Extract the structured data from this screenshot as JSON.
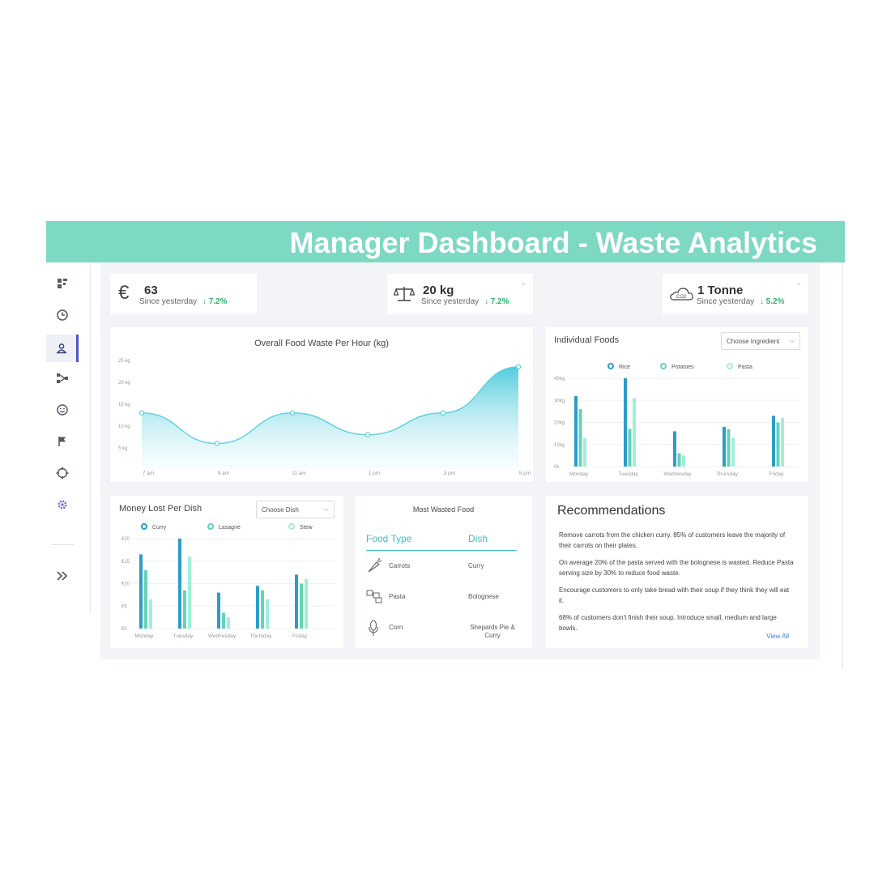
{
  "banner": {
    "title": "Manager Dashboard - Waste Analytics"
  },
  "sidebar": {
    "items": [
      {
        "icon": "dashboard-icon",
        "active": false
      },
      {
        "icon": "clock-icon",
        "active": false
      },
      {
        "icon": "user-icon",
        "active": true
      },
      {
        "icon": "flow-icon",
        "active": false
      },
      {
        "icon": "smiley-icon",
        "active": false
      },
      {
        "icon": "flag-icon",
        "active": false
      },
      {
        "icon": "target-icon",
        "active": false
      },
      {
        "icon": "settings-icon",
        "active": false
      }
    ],
    "expand_icon": "double-chevron-right-icon"
  },
  "stats": [
    {
      "icon": "euro-icon",
      "value": "63",
      "label": "Since yesterday",
      "change": "7.2%",
      "direction": "down"
    },
    {
      "icon": "scale-icon",
      "value": "20 kg",
      "label": "Since yesterday",
      "change": "7.2%",
      "direction": "down"
    },
    {
      "icon": "co2-cloud-icon",
      "icon_text": "CO2",
      "value": "1 Tonne",
      "label": "Since yesterday",
      "change": "5.2%",
      "direction": "down"
    }
  ],
  "colors": {
    "accent": "#7dd8c4",
    "series_dark": "#2e9cc8",
    "series_mid": "#66d1b8",
    "series_light": "#9ff0d6",
    "positive": "#2fb36f",
    "link": "#3d7fd6"
  },
  "chart_data": [
    {
      "type": "area",
      "title": "Overall Food Waste Per Hour (kg)",
      "x": [
        "7 am",
        "9 am",
        "11 am",
        "1 pm",
        "3 pm",
        "5 pm"
      ],
      "values": [
        13,
        6,
        13,
        8,
        13,
        23.5
      ],
      "y_ticks": [
        "25 kg",
        "20 kg",
        "15 kg",
        "10 kg",
        "5 kg"
      ],
      "y_tick_values": [
        25,
        20,
        15,
        10,
        5
      ],
      "ylim": [
        0,
        27
      ],
      "grid": false
    },
    {
      "type": "bar",
      "title": "Individual Foods",
      "dropdown": "Choose Ingredient",
      "categories": [
        "Monday",
        "Tuesday",
        "Wednesday",
        "Thursday",
        "Friday"
      ],
      "series": [
        {
          "name": "Rice",
          "values": [
            32,
            40,
            16,
            18,
            23
          ]
        },
        {
          "name": "Potatoes",
          "values": [
            26,
            17,
            6,
            17,
            20
          ]
        },
        {
          "name": "Pasta",
          "values": [
            13,
            31,
            5,
            13,
            22
          ]
        }
      ],
      "y_ticks": [
        "40kg",
        "30kg",
        "20kg",
        "10kg",
        "0k"
      ],
      "y_tick_values": [
        40,
        30,
        20,
        10,
        0
      ],
      "ylim": [
        0,
        40
      ],
      "grid": true,
      "legend": "top"
    },
    {
      "type": "bar",
      "title": "Money Lost Per Dish",
      "dropdown": "Choose Dish",
      "categories": [
        "Monday",
        "Tuesday",
        "Wednesday",
        "Thursday",
        "Friday"
      ],
      "series": [
        {
          "name": "Curry",
          "values": [
            16.5,
            20,
            8,
            9.5,
            12
          ]
        },
        {
          "name": "Lasagne",
          "values": [
            13,
            8.5,
            3.5,
            8.5,
            10
          ]
        },
        {
          "name": "Stew",
          "values": [
            6.5,
            16,
            2.5,
            6.5,
            11
          ]
        }
      ],
      "y_ticks": [
        "€20",
        "€15",
        "€10",
        "€5",
        "€0"
      ],
      "y_tick_values": [
        20,
        15,
        10,
        5,
        0
      ],
      "ylim": [
        0,
        20
      ],
      "grid": true,
      "legend": "top"
    }
  ],
  "most_wasted": {
    "title": "Most Wasted Food",
    "col_food": "Food Type",
    "col_dish": "Dish",
    "rows": [
      {
        "icon": "carrot-icon",
        "food": "Carrots",
        "dish": "Curry"
      },
      {
        "icon": "pasta-icon",
        "food": "Pasta",
        "dish": "Bolognese"
      },
      {
        "icon": "corn-icon",
        "food": "Corn",
        "dish": "Shepards Pie & Curry"
      }
    ]
  },
  "recommendations": {
    "title": "Recommendations",
    "items": [
      "Remove carrots from the chicken curry. 85% of customers leave the majority of their carrots on their plates.",
      "On average 20% of the pasta served with the bolognese is wasted. Reduce Pasta serving size by 30% to reduce food waste.",
      "Encourage customers to only take bread with their soup if they think they will eat it.",
      "68% of customers don't finish their soup. Introduce small, medium and large bowls."
    ],
    "link": "View All"
  }
}
